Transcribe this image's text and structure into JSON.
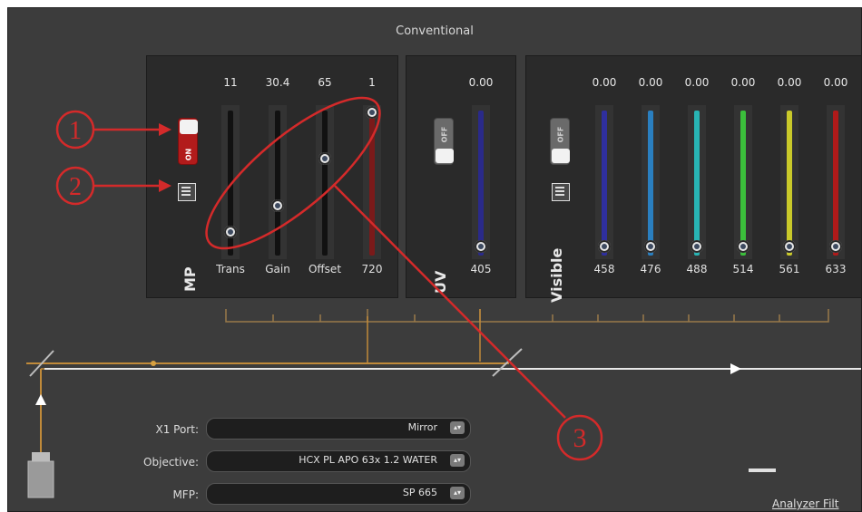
{
  "title": "Conventional",
  "mp": {
    "section_label": "MP",
    "toggle_label": "ON",
    "sliders": [
      {
        "label": "Trans",
        "value": "11",
        "level": 0.11,
        "color": "#111111"
      },
      {
        "label": "Gain",
        "value": "30.4",
        "level": 0.3,
        "color": "#111111"
      },
      {
        "label": "Offset",
        "value": "65",
        "level": 0.65,
        "color": "#111111"
      },
      {
        "label": "720",
        "value": "1",
        "level": 0.99,
        "color": "#7a1a1a"
      }
    ]
  },
  "uv": {
    "section_label": "UV",
    "percent_label": "%",
    "toggle_label": "OFF",
    "sliders": [
      {
        "label": "405",
        "value": "0.00",
        "level": 0.0,
        "color": "#2a2a8a"
      }
    ]
  },
  "visible": {
    "section_label": "Visible",
    "percent_label": "%",
    "toggle_label": "OFF",
    "sliders": [
      {
        "label": "458",
        "value": "0.00",
        "level": 0.0,
        "color": "#2f2f9e"
      },
      {
        "label": "476",
        "value": "0.00",
        "level": 0.0,
        "color": "#2a7fc0"
      },
      {
        "label": "488",
        "value": "0.00",
        "level": 0.0,
        "color": "#28b4b4"
      },
      {
        "label": "514",
        "value": "0.00",
        "level": 0.0,
        "color": "#3bbf3b"
      },
      {
        "label": "561",
        "value": "0.00",
        "level": 0.0,
        "color": "#c9c92a"
      },
      {
        "label": "633",
        "value": "0.00",
        "level": 0.0,
        "color": "#b01a1a"
      }
    ]
  },
  "annotations": {
    "one": "1",
    "two": "2",
    "three": "3",
    "color": "#d42a2a"
  },
  "fields": [
    {
      "label": "X1 Port:",
      "value": "Mirror"
    },
    {
      "label": "Objective:",
      "value": "HCX PL APO 63x 1.2 WATER"
    },
    {
      "label": "MFP:",
      "value": "SP 665"
    }
  ],
  "analyzer_label": "Analyzer Filt"
}
